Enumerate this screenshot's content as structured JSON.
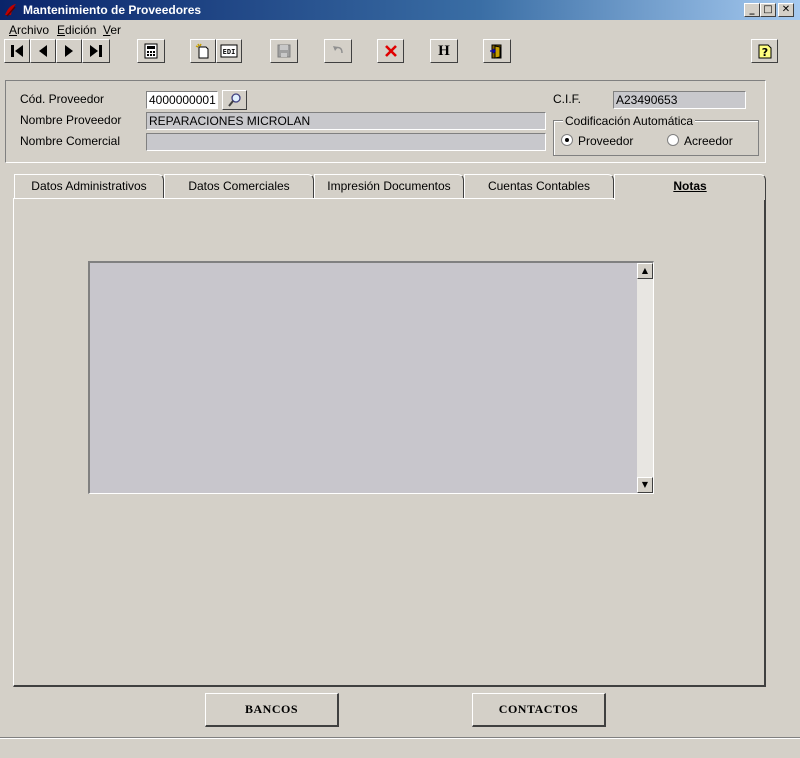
{
  "window": {
    "title": "Mantenimiento de Proveedores",
    "controls": {
      "minimize": "_",
      "maximize": "□",
      "close": "✕"
    }
  },
  "menu": {
    "items": [
      "Archivo",
      "Edición",
      "Ver"
    ]
  },
  "toolbar": {
    "buttons": [
      "first-record-icon",
      "prev-record-icon",
      "next-record-icon",
      "last-record-icon",
      "calculator-icon",
      "new-record-icon",
      "edit-icon",
      "save-icon",
      "undo-icon",
      "delete-icon",
      "history-icon",
      "exit-icon",
      "help-icon"
    ],
    "edit_label": "EDI",
    "history_label": "H",
    "help_label": "?"
  },
  "form": {
    "cod_label": "Cód. Proveedor",
    "cod_value": "4000000001",
    "nombre_label": "Nombre Proveedor",
    "nombre_value": "REPARACIONES MICROLAN",
    "comercial_label": "Nombre Comercial",
    "comercial_value": "",
    "cif_label": "C.I.F.",
    "cif_value": "A23490653",
    "codificacion": {
      "title": "Codificación Automática",
      "options": [
        "Proveedor",
        "Acreedor"
      ],
      "selected": "Proveedor"
    }
  },
  "tabs": [
    {
      "label": "Datos Administrativos"
    },
    {
      "label": "Datos Comerciales"
    },
    {
      "label": "Impresión Documentos"
    },
    {
      "label": "Cuentas Contables"
    },
    {
      "label": "Notas",
      "active": true
    }
  ],
  "notes": {
    "value": ""
  },
  "bottom_buttons": {
    "bancos": "BANCOS",
    "contactos": "CONTACTOS"
  },
  "colors": {
    "titlebar_start": "#0a246a",
    "titlebar_end": "#a6caf0",
    "delete_red": "#e00000"
  }
}
